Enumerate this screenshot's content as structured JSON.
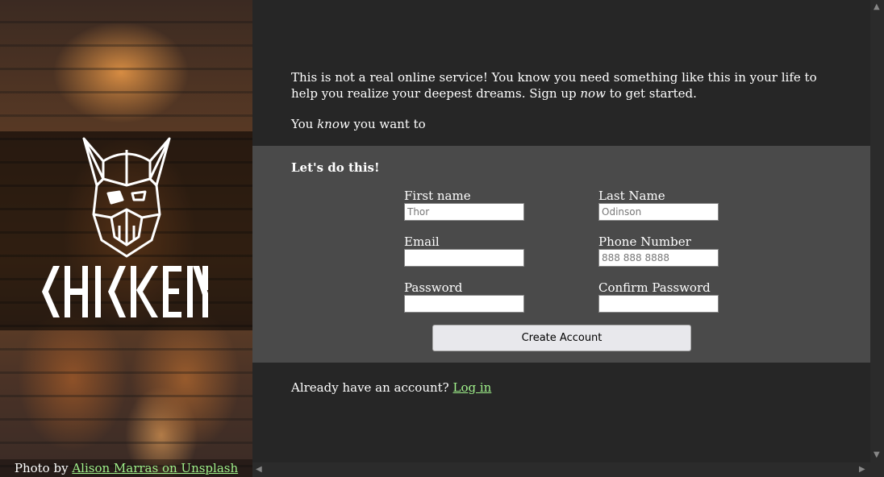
{
  "intro": {
    "line1_before": "This is not a real online service! You know you need something like this in your life to help you realize your deepest dreams. Sign up ",
    "line1_em": "now",
    "line1_after": " to get started.",
    "line2_before": "You ",
    "line2_em": "know",
    "line2_after": " you want to"
  },
  "brand": {
    "name": "CHICKEN"
  },
  "form": {
    "heading": "Let's do this!",
    "first_name": {
      "label": "First name",
      "placeholder": "Thor"
    },
    "last_name": {
      "label": "Last Name",
      "placeholder": "Odinson"
    },
    "email": {
      "label": "Email",
      "placeholder": ""
    },
    "phone": {
      "label": "Phone Number",
      "placeholder": "888 888 8888"
    },
    "password": {
      "label": "Password",
      "placeholder": ""
    },
    "confirm_password": {
      "label": "Confirm Password",
      "placeholder": ""
    },
    "submit_label": "Create Account"
  },
  "login": {
    "prompt": "Already have an account? ",
    "link_label": "Log in"
  },
  "credit": {
    "prefix": "Photo by ",
    "link_label": "Alison Marras on Unsplash"
  },
  "colors": {
    "accent_link": "#9ff08a",
    "panel_bg": "#4a4a4a",
    "page_bg": "#262626"
  },
  "scrollbar": {
    "up": "▲",
    "down": "▼",
    "left": "◀",
    "right": "▶"
  }
}
